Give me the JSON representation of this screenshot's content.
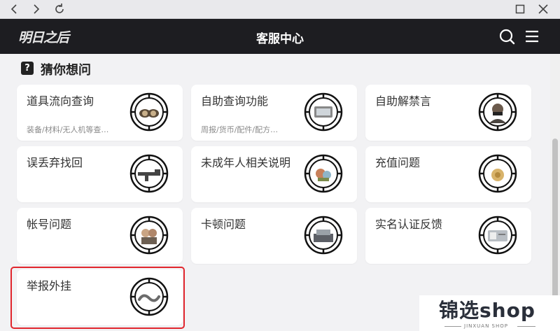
{
  "header": {
    "logo": "明日之后",
    "title": "客服中心"
  },
  "section": {
    "icon_char": "?",
    "title": "猜你想问"
  },
  "cards": [
    {
      "label": "道具流向查询",
      "sub": "装备/材料/无人机等查…",
      "icon": "goggles-icon"
    },
    {
      "label": "自助查询功能",
      "sub": "周报/货币/配件/配方…",
      "icon": "device-icon"
    },
    {
      "label": "自助解禁言",
      "sub": "",
      "icon": "masked-character-icon"
    },
    {
      "label": "误丢弃找回",
      "sub": "",
      "icon": "rifle-icon"
    },
    {
      "label": "未成年人相关说明",
      "sub": "",
      "icon": "toy-icon"
    },
    {
      "label": "充值问题",
      "sub": "",
      "icon": "coin-bag-icon"
    },
    {
      "label": "帐号问题",
      "sub": "",
      "icon": "characters-icon"
    },
    {
      "label": "卡顿问题",
      "sub": "",
      "icon": "machine-icon"
    },
    {
      "label": "实名认证反馈",
      "sub": "",
      "icon": "id-card-icon"
    },
    {
      "label": "举报外挂",
      "sub": "",
      "icon": "snake-icon"
    }
  ],
  "watermark": {
    "brand": "锦选shop",
    "tagline": "JINXUAN SHOP"
  },
  "colors": {
    "header_bg": "#1d1d21",
    "page_bg": "#f2f2f4",
    "highlight": "#e1262d"
  }
}
